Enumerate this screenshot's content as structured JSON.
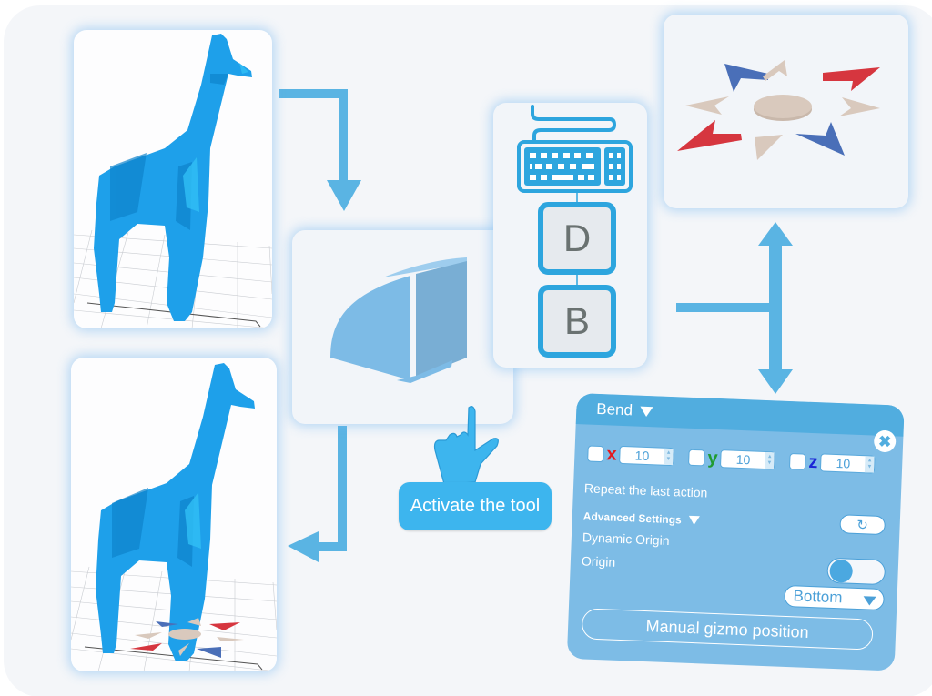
{
  "diagram": {
    "steps": [
      {
        "id": "model-original",
        "label": "Giraffe 3D model"
      },
      {
        "id": "tool-monitor",
        "label": "Bend tool icon"
      },
      {
        "id": "shortcut",
        "label": "Keyboard shortcut",
        "keys": [
          "D",
          "B"
        ]
      },
      {
        "id": "gizmo",
        "label": "Bend gizmo"
      },
      {
        "id": "model-with-gizmo",
        "label": "Giraffe with gizmo"
      }
    ],
    "activate_label": "Activate the tool"
  },
  "bend_panel": {
    "title": "Bend",
    "axes": [
      {
        "letter": "x",
        "value": "10",
        "color": "#e3191f",
        "checked": false
      },
      {
        "letter": "y",
        "value": "10",
        "color": "#1f9b31",
        "checked": false
      },
      {
        "letter": "z",
        "value": "10",
        "color": "#1c27d6",
        "checked": false
      }
    ],
    "repeat_label": "Repeat the last action",
    "advanced_label": "Advanced Settings",
    "dynamic_origin_label": "Dynamic Origin",
    "dynamic_origin_on": true,
    "origin_label": "Origin",
    "origin_value": "Bottom",
    "manual_gizmo_label": "Manual gizmo position",
    "close_icon": "close-icon",
    "repeat_icon": "refresh-icon"
  },
  "colors": {
    "accent": "#51addf",
    "panel": "#7dbce6",
    "model": "#1ea0ea",
    "arrow": "#5ab4e3",
    "gizmo_red": "#d6363f",
    "gizmo_blue": "#4a6fb8",
    "gizmo_beige": "#d9c9bd"
  }
}
